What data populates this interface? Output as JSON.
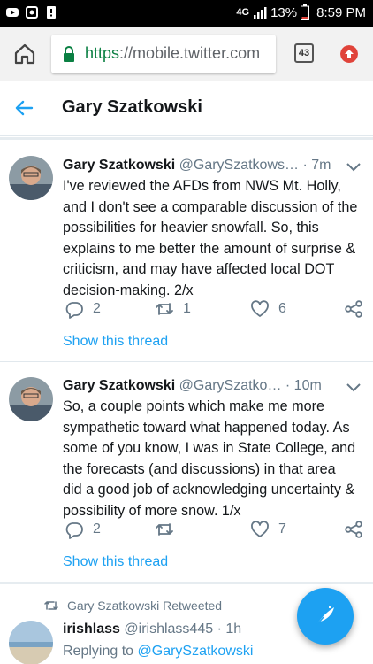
{
  "status_bar": {
    "network": "4G",
    "battery": "13%",
    "time": "8:59 PM",
    "left_icons": [
      "youtube-icon",
      "sync-icon",
      "alert-icon"
    ]
  },
  "browser": {
    "url_scheme": "https",
    "url_rest": "://mobile.twitter.com",
    "tab_count": "43"
  },
  "header": {
    "title": "Gary Szatkowski"
  },
  "tweets": [
    {
      "name": "Gary Szatkowski",
      "handle": "@GarySzatkows…",
      "time": "· 7m",
      "lines": [
        "I've reviewed the AFDs from NWS Mt. Holly,",
        "and I don't see a comparable discussion of the",
        "possibilities for heavier snowfall. So, this",
        "explains to me better the amount of surprise &",
        "criticism, and may have affected local DOT",
        "decision-making. 2/x"
      ],
      "replies": "2",
      "retweets": "1",
      "likes": "6",
      "show_thread": "Show this thread"
    },
    {
      "name": "Gary Szatkowski",
      "handle": "@GarySzatko…",
      "time": "· 10m",
      "lines": [
        "So, a couple points which make me more",
        "sympathetic toward what happened today. As",
        "some of you know, I was in State College, and",
        "the forecasts (and discussions) in that area",
        "did a good job of acknowledging uncertainty &",
        "possibility of more snow. 1/x"
      ],
      "replies": "2",
      "retweets": "",
      "likes": "7",
      "show_thread": "Show this thread"
    }
  ],
  "retweeted": {
    "label": "Gary Szatkowski Retweeted",
    "name": "irishlass",
    "handle": "@irishlass445",
    "time": "· 1h",
    "replying_prefix": "Replying to ",
    "replying_to": "@GarySzatkowski"
  },
  "colors": {
    "accent": "#1da1f2",
    "secondary_text": "#657786",
    "url_green": "#0b8043"
  }
}
